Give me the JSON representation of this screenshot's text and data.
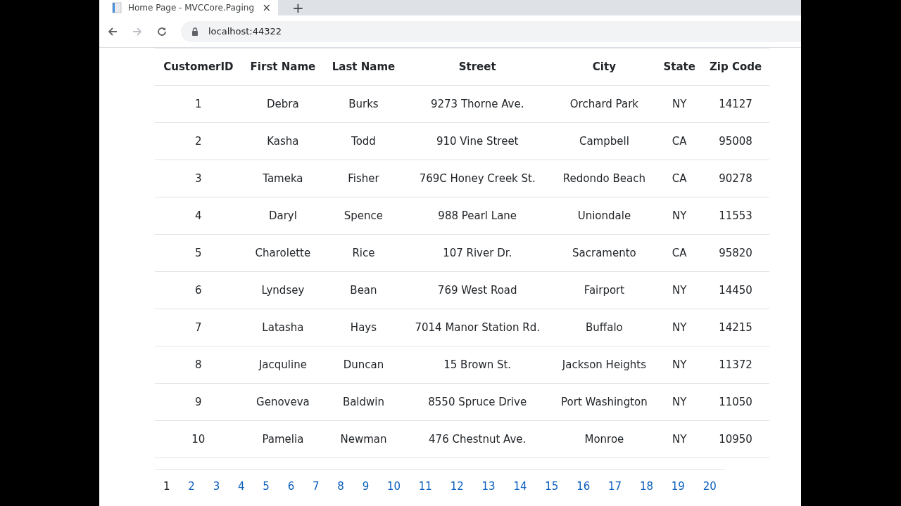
{
  "browser": {
    "tab_title": "Home Page - MVCCore.Paging",
    "close": "×",
    "new_tab": "+",
    "address": "localhost:44322"
  },
  "table": {
    "columns": [
      "CustomerID",
      "First Name",
      "Last Name",
      "Street",
      "City",
      "State",
      "Zip Code"
    ],
    "rows": [
      [
        "1",
        "Debra",
        "Burks",
        "9273 Thorne Ave.",
        "Orchard Park",
        "NY",
        "14127"
      ],
      [
        "2",
        "Kasha",
        "Todd",
        "910 Vine Street",
        "Campbell",
        "CA",
        "95008"
      ],
      [
        "3",
        "Tameka",
        "Fisher",
        "769C Honey Creek St.",
        "Redondo Beach",
        "CA",
        "90278"
      ],
      [
        "4",
        "Daryl",
        "Spence",
        "988 Pearl Lane",
        "Uniondale",
        "NY",
        "11553"
      ],
      [
        "5",
        "Charolette",
        "Rice",
        "107 River Dr.",
        "Sacramento",
        "CA",
        "95820"
      ],
      [
        "6",
        "Lyndsey",
        "Bean",
        "769 West Road",
        "Fairport",
        "NY",
        "14450"
      ],
      [
        "7",
        "Latasha",
        "Hays",
        "7014 Manor Station Rd.",
        "Buffalo",
        "NY",
        "14215"
      ],
      [
        "8",
        "Jacquline",
        "Duncan",
        "15 Brown St.",
        "Jackson Heights",
        "NY",
        "11372"
      ],
      [
        "9",
        "Genoveva",
        "Baldwin",
        "8550 Spruce Drive",
        "Port Washington",
        "NY",
        "11050"
      ],
      [
        "10",
        "Pamelia",
        "Newman",
        "476 Chestnut Ave.",
        "Monroe",
        "NY",
        "10950"
      ]
    ]
  },
  "pagination": [
    {
      "label": "1",
      "selected": true
    },
    {
      "label": "2",
      "selected": false
    },
    {
      "label": "3",
      "selected": false
    },
    {
      "label": "4",
      "selected": false
    },
    {
      "label": "5",
      "selected": false
    },
    {
      "label": "6",
      "selected": false
    },
    {
      "label": "7",
      "selected": false
    },
    {
      "label": "8",
      "selected": false
    },
    {
      "label": "9",
      "selected": false
    },
    {
      "label": "10",
      "selected": false
    },
    {
      "label": "11",
      "selected": false
    },
    {
      "label": "12",
      "selected": false
    },
    {
      "label": "13",
      "selected": false
    },
    {
      "label": "14",
      "selected": false
    },
    {
      "label": "15",
      "selected": false
    },
    {
      "label": "16",
      "selected": false
    },
    {
      "label": "17",
      "selected": false
    },
    {
      "label": "18",
      "selected": false
    },
    {
      "label": "19",
      "selected": false
    },
    {
      "label": "20",
      "selected": false
    }
  ]
}
